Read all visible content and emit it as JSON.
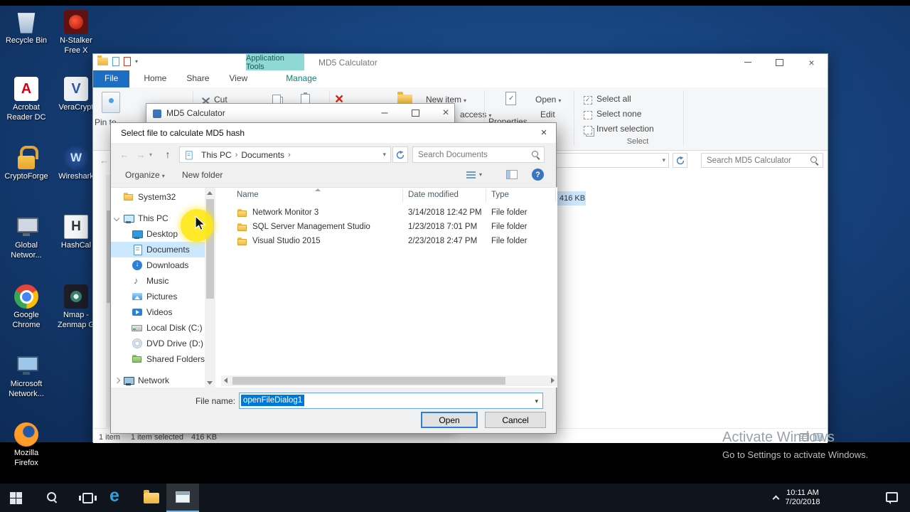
{
  "icons": {
    "back": "←",
    "forward": "→",
    "up": "↑",
    "caret": "▾",
    "crumb_sep": "›",
    "close": "×",
    "minimize": "–",
    "delete": "×"
  },
  "desktop": {
    "icons_col1": [
      {
        "name": "recycle-bin",
        "label": "Recycle Bin"
      },
      {
        "name": "acrobat",
        "label": "Acrobat Reader DC"
      },
      {
        "name": "cryptoforge",
        "label": "CryptoForge"
      },
      {
        "name": "global-network",
        "label": "Global Networ..."
      },
      {
        "name": "chrome",
        "label": "Google Chrome"
      },
      {
        "name": "ms-network",
        "label": "Microsoft Network..."
      },
      {
        "name": "firefox",
        "label": "Mozilla Firefox"
      }
    ],
    "icons_col2": [
      {
        "name": "nstalker",
        "label": "N-Stalker Free X"
      },
      {
        "name": "veracrypt",
        "label": "VeraCrypt"
      },
      {
        "name": "wireshark",
        "label": "Wireshark"
      },
      {
        "name": "hashcalc",
        "label": "HashCal"
      },
      {
        "name": "nmap",
        "label": "Nmap - Zenmap G"
      }
    ],
    "activate_line1": "Activate Windows",
    "activate_line2": "Go to Settings to activate Windows."
  },
  "explorer": {
    "title": "MD5 Calculator",
    "contextual_tab": "Application Tools",
    "tabs": {
      "file": "File",
      "home": "Home",
      "share": "Share",
      "view": "View",
      "manage": "Manage"
    },
    "ribbon": {
      "pin": "Pin to",
      "cut": "Cut",
      "new_item": "New item",
      "easy_access": "access",
      "properties": "Properties",
      "open": "Open",
      "edit": "Edit",
      "select_all": "Select all",
      "select_none": "Select none",
      "invert": "Invert selection",
      "select_group": "Select"
    },
    "search_placeholder": "Search MD5 Calculator",
    "selected_size": "416 KB",
    "status_items": "1 item",
    "status_selected": "1 item selected"
  },
  "md5_window": {
    "title": "MD5 Calculator"
  },
  "dialog": {
    "title": "Select file to calculate MD5 hash",
    "nav": {
      "crumb_root": "This PC",
      "crumb_current": "Documents",
      "search_placeholder": "Search Documents"
    },
    "toolbar": {
      "organize": "Organize",
      "new_folder": "New folder"
    },
    "sidebar": [
      {
        "label": "System32",
        "icon": "folder",
        "level": 1
      },
      {
        "label": "This PC",
        "icon": "pc",
        "level": 1,
        "gap": 8,
        "chevron": "open"
      },
      {
        "label": "Desktop",
        "icon": "desktop",
        "level": 2
      },
      {
        "label": "Documents",
        "icon": "documents",
        "level": 2,
        "selected": true
      },
      {
        "label": "Downloads",
        "icon": "downloads",
        "level": 2
      },
      {
        "label": "Music",
        "icon": "music",
        "level": 2
      },
      {
        "label": "Pictures",
        "icon": "pictures",
        "level": 2
      },
      {
        "label": "Videos",
        "icon": "videos",
        "level": 2
      },
      {
        "label": "Local Disk (C:)",
        "icon": "disk",
        "level": 2
      },
      {
        "label": "DVD Drive (D:) C",
        "icon": "dvd",
        "level": 2
      },
      {
        "label": "Shared Folders (",
        "icon": "shared",
        "level": 2
      },
      {
        "label": "Network",
        "icon": "network",
        "level": 1,
        "gap": 8,
        "chevron": "closed"
      }
    ],
    "columns": {
      "name": "Name",
      "date": "Date modified",
      "type": "Type"
    },
    "files": [
      {
        "name": "Network Monitor 3",
        "date": "3/14/2018 12:42 PM",
        "type": "File folder"
      },
      {
        "name": "SQL Server Management Studio",
        "date": "1/23/2018 7:01 PM",
        "type": "File folder"
      },
      {
        "name": "Visual Studio 2015",
        "date": "2/23/2018 2:47 PM",
        "type": "File folder"
      }
    ],
    "filename_label": "File name:",
    "filename_value": "openFileDialog1",
    "open_label": "Open",
    "cancel_label": "Cancel"
  },
  "taskbar": {
    "time": "10:11 AM",
    "date": "7/20/2018"
  }
}
